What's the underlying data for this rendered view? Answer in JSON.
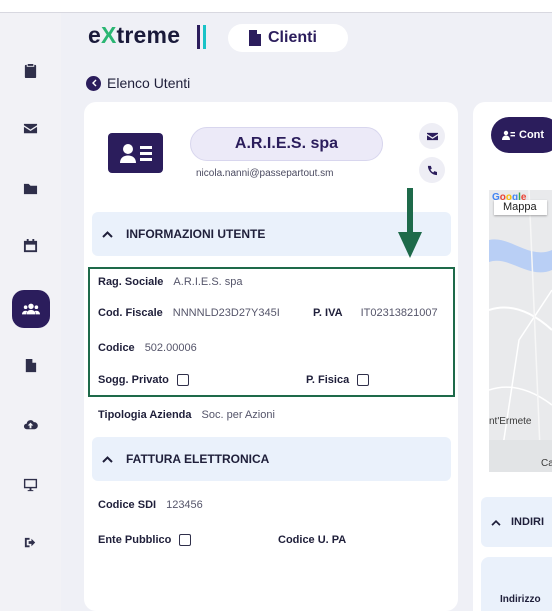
{
  "app": {
    "logo_prefix": "e",
    "logo_x": "X",
    "logo_suffix": "treme",
    "page_title": "Clienti"
  },
  "nav": {
    "back_label": "Elenco Utenti"
  },
  "sidebar": {
    "items": [
      "clipboard-icon",
      "mail-icon",
      "folder-icon",
      "calendar-icon",
      "users-icon",
      "document-icon",
      "cloud-upload-icon",
      "monitor-icon",
      "logout-icon"
    ],
    "active": "users-icon"
  },
  "client": {
    "name": "A.R.I.E.S. spa",
    "email": "nicola.nanni@passepartout.sm"
  },
  "section_user": {
    "title": "INFORMAZIONI UTENTE",
    "rag_sociale_label": "Rag. Sociale",
    "rag_sociale": "A.R.I.E.S. spa",
    "cod_fiscale_label": "Cod. Fiscale",
    "cod_fiscale": "NNNNLD23D27Y345I",
    "piva_label": "P. IVA",
    "piva": "IT02313821007",
    "codice_label": "Codice",
    "codice": "502.00006",
    "sogg_privato_label": "Sogg. Privato",
    "sogg_privato_checked": false,
    "p_fisica_label": "P. Fisica",
    "p_fisica_checked": false,
    "tipologia_label": "Tipologia Azienda",
    "tipologia": "Soc. per Azioni"
  },
  "section_invoice": {
    "title": "FATTURA ELETTRONICA",
    "codice_sdi_label": "Codice SDI",
    "codice_sdi": "123456",
    "ente_pubblico_label": "Ente Pubblico",
    "ente_pubblico_checked": false,
    "codice_upa_label": "Codice U. PA"
  },
  "right": {
    "contact_label": "Cont",
    "map_google": "Google",
    "map_button": "Mappa",
    "map_place1": "nt'Ermete",
    "map_place2": "Ca",
    "address_section": "INDIRI",
    "address_label": "Indirizzo"
  },
  "colors": {
    "primary": "#2b1d5c",
    "accent_green": "#1e6a4a",
    "logo_x": "#2bb673",
    "section_bg": "#eaf1fb"
  }
}
